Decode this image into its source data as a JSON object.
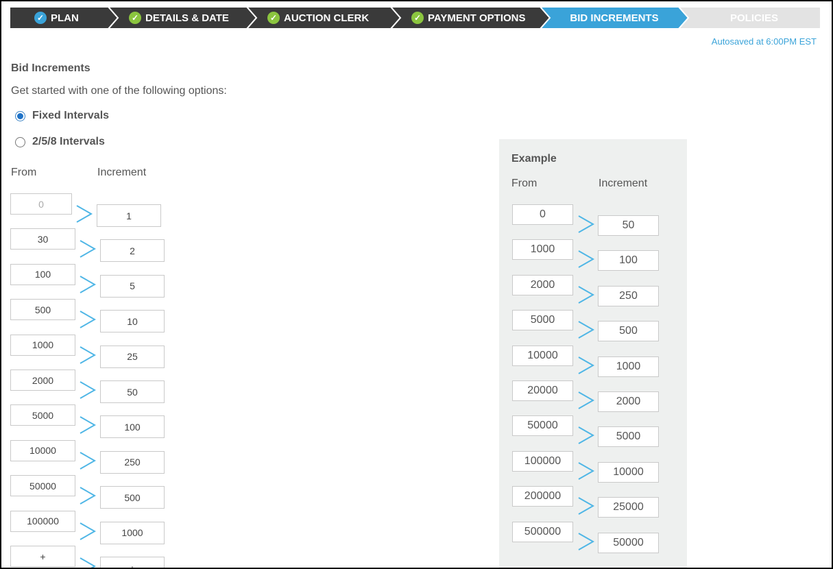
{
  "stepper": {
    "steps": [
      {
        "label": "PLAN",
        "state": "current-done",
        "color": "#3a3a3a",
        "check_color": "#3aa3d9"
      },
      {
        "label": "DETAILS & DATE",
        "state": "done",
        "color": "#3a3a3a",
        "check_color": "#8bc53f"
      },
      {
        "label": "AUCTION CLERK",
        "state": "done",
        "color": "#3a3a3a",
        "check_color": "#8bc53f"
      },
      {
        "label": "PAYMENT OPTIONS",
        "state": "done",
        "color": "#3a3a3a",
        "check_color": "#8bc53f"
      },
      {
        "label": "BID INCREMENTS",
        "state": "active",
        "color": "#3aa3d9"
      },
      {
        "label": "POLICIES",
        "state": "upcoming",
        "color": "#e3e3e3"
      }
    ]
  },
  "autosave": "Autosaved at 6:00PM EST",
  "section": {
    "title": "Bid Increments",
    "intro": "Get started with one of the following options:"
  },
  "options": [
    {
      "label": "Fixed Intervals",
      "checked": true
    },
    {
      "label": "2/5/8 Intervals",
      "checked": false
    }
  ],
  "editor": {
    "from_label": "From",
    "increment_label": "Increment",
    "rows": [
      {
        "from": "0",
        "increment": "1"
      },
      {
        "from": "30",
        "increment": "2"
      },
      {
        "from": "100",
        "increment": "5"
      },
      {
        "from": "500",
        "increment": "10"
      },
      {
        "from": "1000",
        "increment": "25"
      },
      {
        "from": "2000",
        "increment": "50"
      },
      {
        "from": "5000",
        "increment": "100"
      },
      {
        "from": "10000",
        "increment": "250"
      },
      {
        "from": "50000",
        "increment": "500"
      },
      {
        "from": "100000",
        "increment": "1000"
      },
      {
        "from": "+",
        "increment": "+"
      }
    ]
  },
  "example": {
    "title": "Example",
    "from_label": "From",
    "increment_label": "Increment",
    "rows": [
      {
        "from": "0",
        "increment": "50"
      },
      {
        "from": "1000",
        "increment": "100"
      },
      {
        "from": "2000",
        "increment": "250"
      },
      {
        "from": "5000",
        "increment": "500"
      },
      {
        "from": "10000",
        "increment": "1000"
      },
      {
        "from": "20000",
        "increment": "2000"
      },
      {
        "from": "50000",
        "increment": "5000"
      },
      {
        "from": "100000",
        "increment": "10000"
      },
      {
        "from": "200000",
        "increment": "25000"
      },
      {
        "from": "500000",
        "increment": "50000"
      }
    ]
  },
  "colors": {
    "accent": "#3aa3d9",
    "done_check": "#8bc53f",
    "chevron": "#4fb6e6"
  }
}
